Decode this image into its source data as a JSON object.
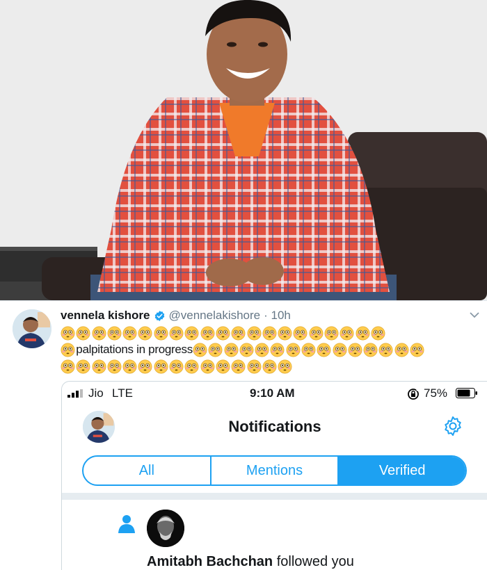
{
  "tweet": {
    "display_name": "vennela kishore",
    "handle": "@vennelakishore",
    "time": "· 10h",
    "text": "palpitations in progress",
    "emoji_name": "flushed-face-emoji",
    "emoji_rows": [
      21,
      1,
      15,
      15
    ],
    "colors": {
      "handle": "#657786",
      "verified": "#1da1f2"
    }
  },
  "screenshot": {
    "status": {
      "carrier": "Jio",
      "network": "LTE",
      "time": "9:10 AM",
      "battery": "75%"
    },
    "title": "Notifications",
    "tabs": [
      {
        "label": "All",
        "active": false
      },
      {
        "label": "Mentions",
        "active": false
      },
      {
        "label": "Verified",
        "active": true
      }
    ],
    "notification": {
      "name": "Amitabh Bachchan",
      "action": "followed you"
    },
    "accent": "#1da1f2"
  }
}
